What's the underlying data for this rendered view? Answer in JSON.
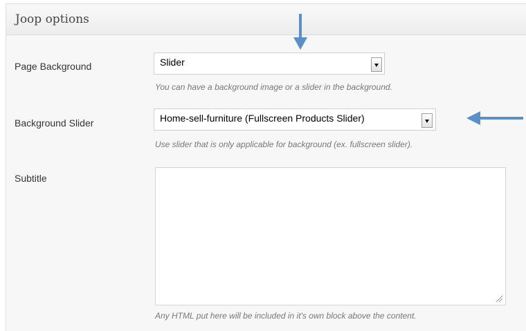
{
  "panel": {
    "title": "Joop options"
  },
  "fields": {
    "page_background": {
      "label": "Page Background",
      "selected": "Slider",
      "help": "You can have a background image or a slider in the background."
    },
    "background_slider": {
      "label": "Background Slider",
      "selected": "Home-sell-furniture (Fullscreen Products Slider)",
      "help": "Use slider that is only applicable for background (ex. fullscreen slider)."
    },
    "subtitle": {
      "label": "Subtitle",
      "value": "",
      "help": "Any HTML put here will be included in it's own block above the content."
    }
  },
  "annotations": {
    "arrow_color": "#5b8fc7"
  }
}
